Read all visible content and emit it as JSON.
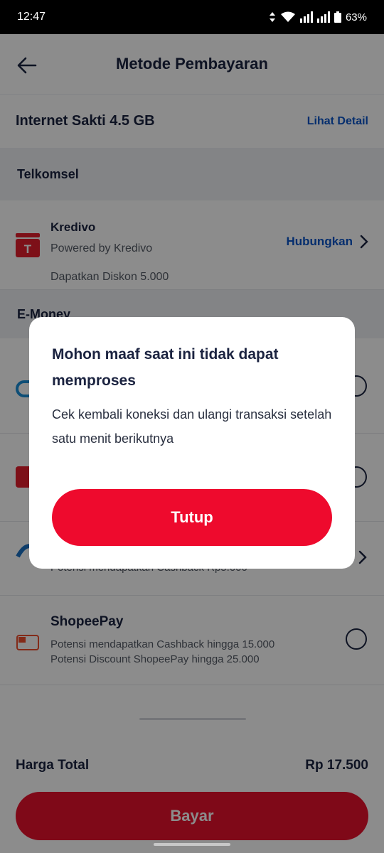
{
  "status_bar": {
    "time": "12:47",
    "battery": "63%"
  },
  "header": {
    "title": "Metode Pembayaran"
  },
  "product": {
    "name": "Internet Sakti 4.5 GB",
    "detail_link": "Lihat Detail"
  },
  "sections": {
    "telkomsel": "Telkomsel",
    "emoney": "E-Money"
  },
  "methods": {
    "kredivo": {
      "name": "Kredivo",
      "subtitle": "Powered by Kredivo",
      "promo": "Dapatkan Diskon 5.000",
      "action": "Hubungkan",
      "logo_letter": "T"
    },
    "emoney_3_promo": "Potensi mendapatkan Cashback Rp5.000",
    "shopeepay": {
      "name": "ShopeePay",
      "promo_1": "Potensi mendapatkan Cashback hingga 15.000",
      "promo_2": "Potensi Discount ShopeePay hingga 25.000"
    }
  },
  "total": {
    "label": "Harga Total",
    "value": "Rp 17.500"
  },
  "pay_button": "Bayar",
  "dialog": {
    "title": "Mohon maaf saat ini tidak dapat memproses",
    "message": "Cek kembali koneksi dan ulangi transaksi setelah satu menit berikutnya",
    "button": "Tutup"
  },
  "colors": {
    "accent_red": "#ee0a2d",
    "link_blue": "#0a55c8",
    "text_dark": "#1b2340"
  }
}
